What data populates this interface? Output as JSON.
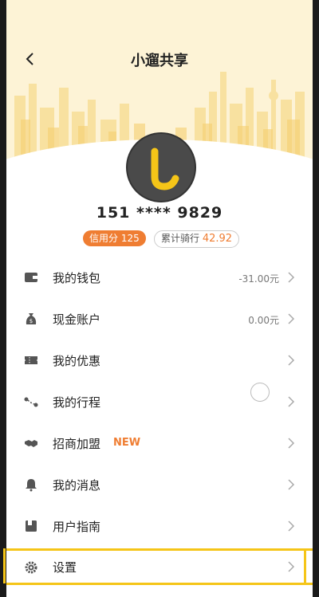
{
  "status_bar": {
    "left": "",
    "right": ""
  },
  "header": {
    "title": "小遛共享"
  },
  "profile": {
    "phone": "151 **** 9829",
    "credit_label": "信用分",
    "credit_value": "125",
    "ride_label": "累计骑行",
    "ride_value": "42.92"
  },
  "menu": [
    {
      "label": "我的钱包",
      "value": "-31.00元",
      "icon": "wallet-icon"
    },
    {
      "label": "现金账户",
      "value": "0.00元",
      "icon": "money-bag-icon"
    },
    {
      "label": "我的优惠",
      "value": "",
      "icon": "ticket-icon"
    },
    {
      "label": "我的行程",
      "value": "",
      "icon": "route-icon"
    },
    {
      "label": "招商加盟",
      "badge": "NEW",
      "icon": "handshake-icon"
    },
    {
      "label": "我的消息",
      "value": "",
      "icon": "bell-icon"
    },
    {
      "label": "用户指南",
      "value": "",
      "icon": "book-icon"
    },
    {
      "label": "设置",
      "value": "",
      "icon": "gear-icon"
    }
  ],
  "colors": {
    "accent": "#ef7d32",
    "header_bg": "#fdf3d6",
    "logo_yellow": "#f5c518",
    "highlight": "#f5c518"
  }
}
